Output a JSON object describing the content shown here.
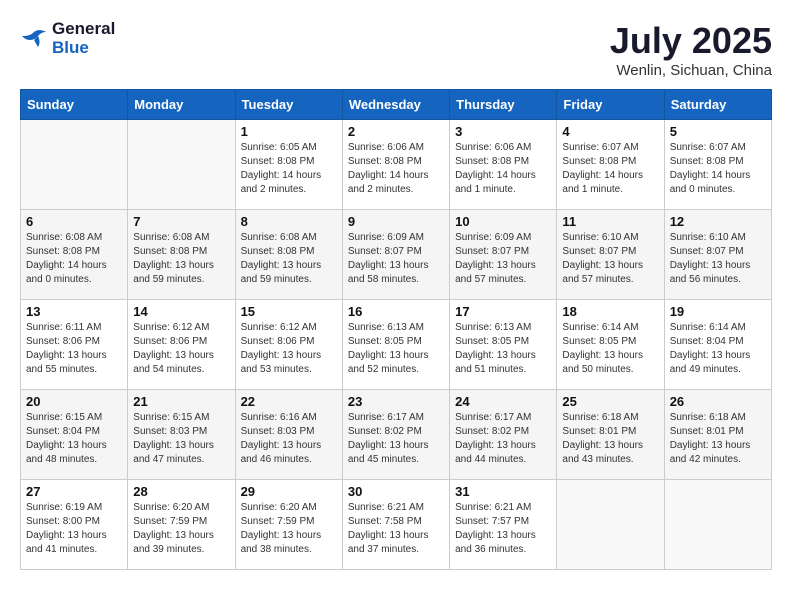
{
  "header": {
    "logo_line1": "General",
    "logo_line2": "Blue",
    "month": "July 2025",
    "location": "Wenlin, Sichuan, China"
  },
  "weekdays": [
    "Sunday",
    "Monday",
    "Tuesday",
    "Wednesday",
    "Thursday",
    "Friday",
    "Saturday"
  ],
  "weeks": [
    [
      {
        "day": "",
        "info": ""
      },
      {
        "day": "",
        "info": ""
      },
      {
        "day": "1",
        "info": "Sunrise: 6:05 AM\nSunset: 8:08 PM\nDaylight: 14 hours and 2 minutes."
      },
      {
        "day": "2",
        "info": "Sunrise: 6:06 AM\nSunset: 8:08 PM\nDaylight: 14 hours and 2 minutes."
      },
      {
        "day": "3",
        "info": "Sunrise: 6:06 AM\nSunset: 8:08 PM\nDaylight: 14 hours and 1 minute."
      },
      {
        "day": "4",
        "info": "Sunrise: 6:07 AM\nSunset: 8:08 PM\nDaylight: 14 hours and 1 minute."
      },
      {
        "day": "5",
        "info": "Sunrise: 6:07 AM\nSunset: 8:08 PM\nDaylight: 14 hours and 0 minutes."
      }
    ],
    [
      {
        "day": "6",
        "info": "Sunrise: 6:08 AM\nSunset: 8:08 PM\nDaylight: 14 hours and 0 minutes."
      },
      {
        "day": "7",
        "info": "Sunrise: 6:08 AM\nSunset: 8:08 PM\nDaylight: 13 hours and 59 minutes."
      },
      {
        "day": "8",
        "info": "Sunrise: 6:08 AM\nSunset: 8:08 PM\nDaylight: 13 hours and 59 minutes."
      },
      {
        "day": "9",
        "info": "Sunrise: 6:09 AM\nSunset: 8:07 PM\nDaylight: 13 hours and 58 minutes."
      },
      {
        "day": "10",
        "info": "Sunrise: 6:09 AM\nSunset: 8:07 PM\nDaylight: 13 hours and 57 minutes."
      },
      {
        "day": "11",
        "info": "Sunrise: 6:10 AM\nSunset: 8:07 PM\nDaylight: 13 hours and 57 minutes."
      },
      {
        "day": "12",
        "info": "Sunrise: 6:10 AM\nSunset: 8:07 PM\nDaylight: 13 hours and 56 minutes."
      }
    ],
    [
      {
        "day": "13",
        "info": "Sunrise: 6:11 AM\nSunset: 8:06 PM\nDaylight: 13 hours and 55 minutes."
      },
      {
        "day": "14",
        "info": "Sunrise: 6:12 AM\nSunset: 8:06 PM\nDaylight: 13 hours and 54 minutes."
      },
      {
        "day": "15",
        "info": "Sunrise: 6:12 AM\nSunset: 8:06 PM\nDaylight: 13 hours and 53 minutes."
      },
      {
        "day": "16",
        "info": "Sunrise: 6:13 AM\nSunset: 8:05 PM\nDaylight: 13 hours and 52 minutes."
      },
      {
        "day": "17",
        "info": "Sunrise: 6:13 AM\nSunset: 8:05 PM\nDaylight: 13 hours and 51 minutes."
      },
      {
        "day": "18",
        "info": "Sunrise: 6:14 AM\nSunset: 8:05 PM\nDaylight: 13 hours and 50 minutes."
      },
      {
        "day": "19",
        "info": "Sunrise: 6:14 AM\nSunset: 8:04 PM\nDaylight: 13 hours and 49 minutes."
      }
    ],
    [
      {
        "day": "20",
        "info": "Sunrise: 6:15 AM\nSunset: 8:04 PM\nDaylight: 13 hours and 48 minutes."
      },
      {
        "day": "21",
        "info": "Sunrise: 6:15 AM\nSunset: 8:03 PM\nDaylight: 13 hours and 47 minutes."
      },
      {
        "day": "22",
        "info": "Sunrise: 6:16 AM\nSunset: 8:03 PM\nDaylight: 13 hours and 46 minutes."
      },
      {
        "day": "23",
        "info": "Sunrise: 6:17 AM\nSunset: 8:02 PM\nDaylight: 13 hours and 45 minutes."
      },
      {
        "day": "24",
        "info": "Sunrise: 6:17 AM\nSunset: 8:02 PM\nDaylight: 13 hours and 44 minutes."
      },
      {
        "day": "25",
        "info": "Sunrise: 6:18 AM\nSunset: 8:01 PM\nDaylight: 13 hours and 43 minutes."
      },
      {
        "day": "26",
        "info": "Sunrise: 6:18 AM\nSunset: 8:01 PM\nDaylight: 13 hours and 42 minutes."
      }
    ],
    [
      {
        "day": "27",
        "info": "Sunrise: 6:19 AM\nSunset: 8:00 PM\nDaylight: 13 hours and 41 minutes."
      },
      {
        "day": "28",
        "info": "Sunrise: 6:20 AM\nSunset: 7:59 PM\nDaylight: 13 hours and 39 minutes."
      },
      {
        "day": "29",
        "info": "Sunrise: 6:20 AM\nSunset: 7:59 PM\nDaylight: 13 hours and 38 minutes."
      },
      {
        "day": "30",
        "info": "Sunrise: 6:21 AM\nSunset: 7:58 PM\nDaylight: 13 hours and 37 minutes."
      },
      {
        "day": "31",
        "info": "Sunrise: 6:21 AM\nSunset: 7:57 PM\nDaylight: 13 hours and 36 minutes."
      },
      {
        "day": "",
        "info": ""
      },
      {
        "day": "",
        "info": ""
      }
    ]
  ]
}
